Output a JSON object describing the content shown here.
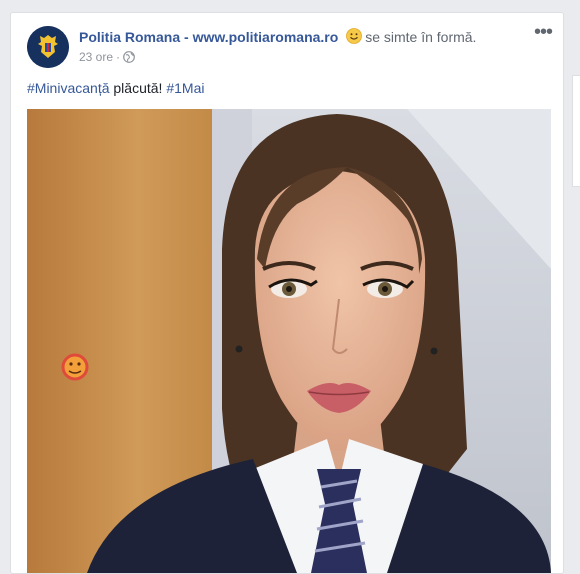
{
  "post": {
    "page_name": "Politia Romana - www.politiaromana.ro",
    "feeling": "se simte în formă.",
    "feeling_icon": "smiling-face-emoji",
    "timestamp": "23 ore",
    "separator": "·",
    "privacy_icon": "globe-icon",
    "more_label": "•••",
    "text_part1": "#Minivacanță",
    "text_part2": " plăcută! ",
    "text_part3": "#1Mai",
    "photo_icon": "photo-sticker-emoji"
  },
  "colors": {
    "link": "#365899",
    "text": "#1d2129",
    "muted": "#90949c",
    "avatar_bg": "#17315f"
  }
}
